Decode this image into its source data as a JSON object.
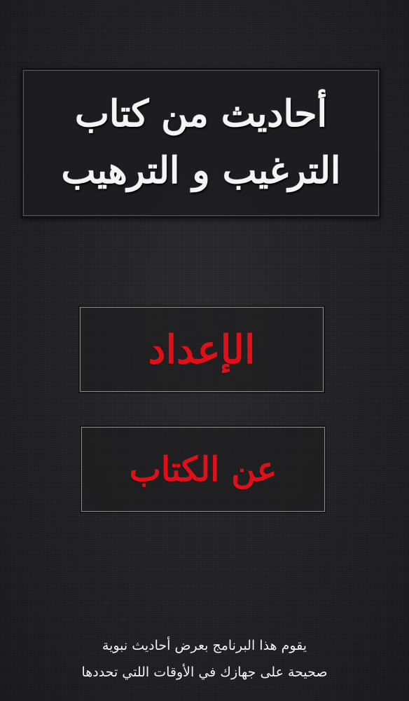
{
  "title": {
    "line1": "أحاديث من كتاب",
    "line2": "الترغيب و الترهيب"
  },
  "menu": {
    "settings_label": "الإعداد",
    "about_label": "عن الكتاب"
  },
  "footer": {
    "line1": "يقوم هذا البرنامج بعرض أحاديث نبوية",
    "line2": "صحيحة على جهازك في الأوقات اللتي تحددها"
  },
  "colors": {
    "background": "#232325",
    "title_text": "#f4f4f4",
    "button_text": "#e0101a",
    "button_border": "#8a8a8a"
  }
}
